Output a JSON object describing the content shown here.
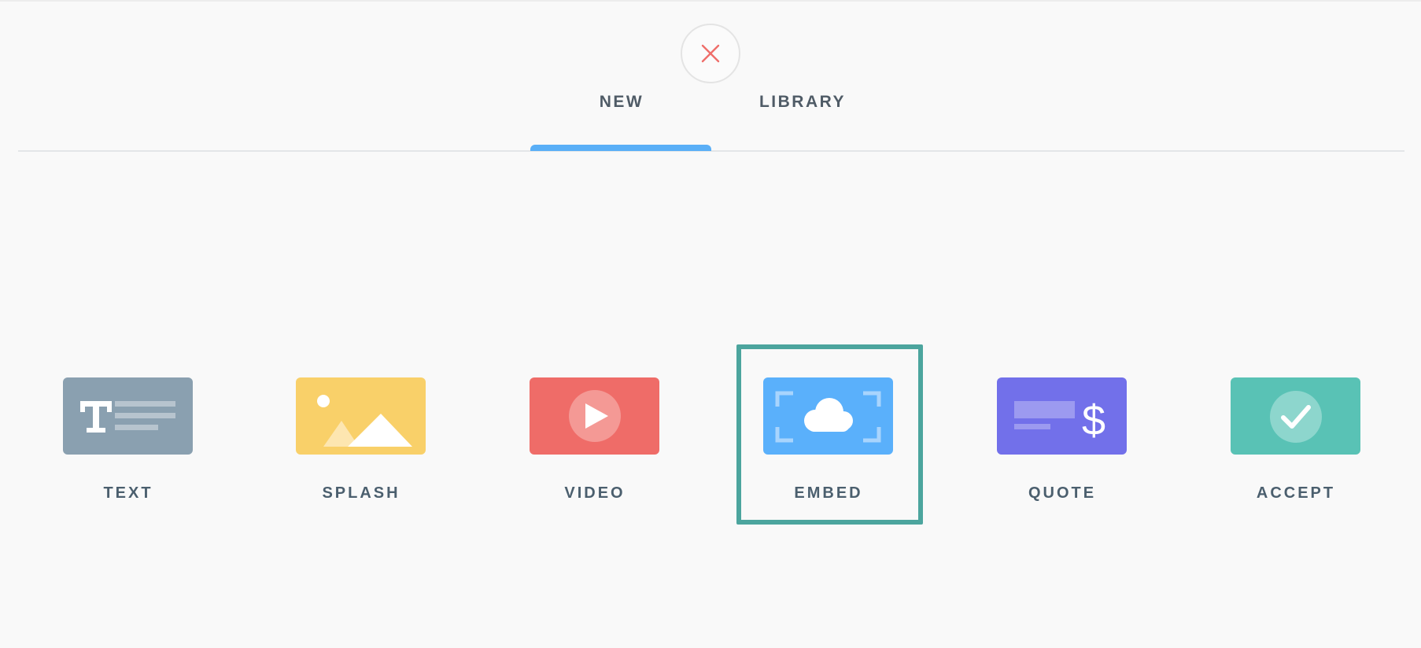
{
  "header": {
    "close_icon": "close-x-icon",
    "close_color": "#ef6e6a",
    "tabs": [
      {
        "label": "NEW",
        "active": true
      },
      {
        "label": "LIBRARY",
        "active": false
      }
    ],
    "active_tab_color": "#5aaff7"
  },
  "blocks": [
    {
      "label": "TEXT",
      "icon": "text-block-icon",
      "color": "#8aa0b0"
    },
    {
      "label": "SPLASH",
      "icon": "splash-image-icon",
      "color": "#f9d069"
    },
    {
      "label": "VIDEO",
      "icon": "video-play-icon",
      "color": "#ef6c68"
    },
    {
      "label": "EMBED",
      "icon": "embed-cloud-icon",
      "color": "#5ab0fb",
      "selected": true
    },
    {
      "label": "QUOTE",
      "icon": "quote-dollar-icon",
      "color": "#7270ea"
    },
    {
      "label": "ACCEPT",
      "icon": "accept-check-icon",
      "color": "#59c2b5"
    }
  ],
  "selection_color": "#4ca59e"
}
